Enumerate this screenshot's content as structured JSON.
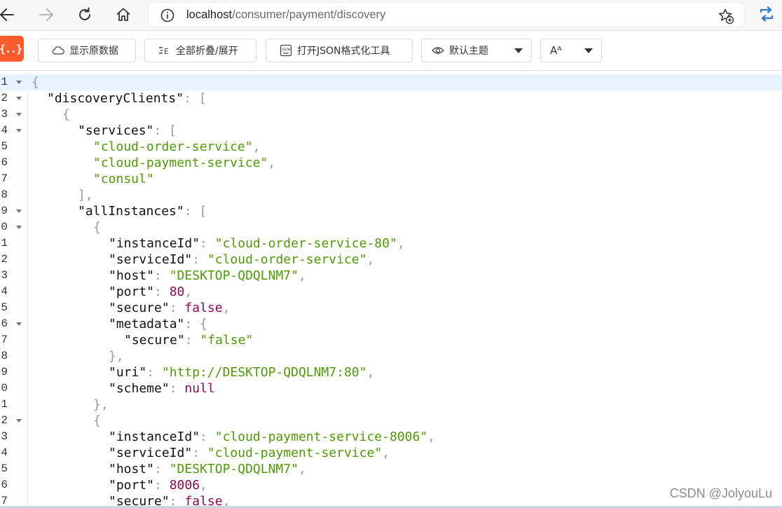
{
  "browser": {
    "url_host": "localhost",
    "url_path": "/consumer/payment/discovery"
  },
  "toolbar": {
    "logo_label": "{..}",
    "show_raw_label": "显示原数据",
    "fold_all_label": "全部折叠/展开",
    "open_formatter_label": "打开JSON格式化工具",
    "theme_label": "默认主题",
    "font_label": "Aᴬ"
  },
  "code": {
    "lines": [
      {
        "num": "1",
        "fold": true,
        "active": true,
        "indent": 0,
        "tokens": [
          {
            "t": "p",
            "v": "{"
          }
        ]
      },
      {
        "num": "2",
        "fold": true,
        "active": false,
        "indent": 1,
        "tokens": [
          {
            "t": "k",
            "v": "\"discoveryClients\""
          },
          {
            "t": "p",
            "v": ": ["
          }
        ]
      },
      {
        "num": "3",
        "fold": true,
        "active": false,
        "indent": 2,
        "tokens": [
          {
            "t": "p",
            "v": "{"
          }
        ]
      },
      {
        "num": "4",
        "fold": true,
        "active": false,
        "indent": 3,
        "tokens": [
          {
            "t": "k",
            "v": "\"services\""
          },
          {
            "t": "p",
            "v": ": ["
          }
        ]
      },
      {
        "num": "5",
        "fold": false,
        "active": false,
        "indent": 4,
        "tokens": [
          {
            "t": "s",
            "v": "\"cloud-order-service\""
          },
          {
            "t": "p",
            "v": ","
          }
        ]
      },
      {
        "num": "6",
        "fold": false,
        "active": false,
        "indent": 4,
        "tokens": [
          {
            "t": "s",
            "v": "\"cloud-payment-service\""
          },
          {
            "t": "p",
            "v": ","
          }
        ]
      },
      {
        "num": "7",
        "fold": false,
        "active": false,
        "indent": 4,
        "tokens": [
          {
            "t": "s",
            "v": "\"consul\""
          }
        ]
      },
      {
        "num": "8",
        "fold": false,
        "active": false,
        "indent": 3,
        "tokens": [
          {
            "t": "p",
            "v": "],"
          }
        ]
      },
      {
        "num": "9",
        "fold": true,
        "active": false,
        "indent": 3,
        "tokens": [
          {
            "t": "k",
            "v": "\"allInstances\""
          },
          {
            "t": "p",
            "v": ": ["
          }
        ]
      },
      {
        "num": "0",
        "fold": true,
        "active": false,
        "indent": 4,
        "tokens": [
          {
            "t": "p",
            "v": "{"
          }
        ]
      },
      {
        "num": "1",
        "fold": false,
        "active": false,
        "indent": 5,
        "tokens": [
          {
            "t": "k",
            "v": "\"instanceId\""
          },
          {
            "t": "p",
            "v": ": "
          },
          {
            "t": "s",
            "v": "\"cloud-order-service-80\""
          },
          {
            "t": "p",
            "v": ","
          }
        ]
      },
      {
        "num": "2",
        "fold": false,
        "active": false,
        "indent": 5,
        "tokens": [
          {
            "t": "k",
            "v": "\"serviceId\""
          },
          {
            "t": "p",
            "v": ": "
          },
          {
            "t": "s",
            "v": "\"cloud-order-service\""
          },
          {
            "t": "p",
            "v": ","
          }
        ]
      },
      {
        "num": "3",
        "fold": false,
        "active": false,
        "indent": 5,
        "tokens": [
          {
            "t": "k",
            "v": "\"host\""
          },
          {
            "t": "p",
            "v": ": "
          },
          {
            "t": "s",
            "v": "\"DESKTOP-QDQLNM7\""
          },
          {
            "t": "p",
            "v": ","
          }
        ]
      },
      {
        "num": "4",
        "fold": false,
        "active": false,
        "indent": 5,
        "tokens": [
          {
            "t": "k",
            "v": "\"port\""
          },
          {
            "t": "p",
            "v": ": "
          },
          {
            "t": "n",
            "v": "80"
          },
          {
            "t": "p",
            "v": ","
          }
        ]
      },
      {
        "num": "5",
        "fold": false,
        "active": false,
        "indent": 5,
        "tokens": [
          {
            "t": "k",
            "v": "\"secure\""
          },
          {
            "t": "p",
            "v": ": "
          },
          {
            "t": "b",
            "v": "false"
          },
          {
            "t": "p",
            "v": ","
          }
        ]
      },
      {
        "num": "6",
        "fold": true,
        "active": false,
        "indent": 5,
        "tokens": [
          {
            "t": "k",
            "v": "\"metadata\""
          },
          {
            "t": "p",
            "v": ": {"
          }
        ]
      },
      {
        "num": "7",
        "fold": false,
        "active": false,
        "indent": 6,
        "tokens": [
          {
            "t": "k",
            "v": "\"secure\""
          },
          {
            "t": "p",
            "v": ": "
          },
          {
            "t": "s",
            "v": "\"false\""
          }
        ]
      },
      {
        "num": "8",
        "fold": false,
        "active": false,
        "indent": 5,
        "tokens": [
          {
            "t": "p",
            "v": "},"
          }
        ]
      },
      {
        "num": "9",
        "fold": false,
        "active": false,
        "indent": 5,
        "tokens": [
          {
            "t": "k",
            "v": "\"uri\""
          },
          {
            "t": "p",
            "v": ": "
          },
          {
            "t": "s",
            "v": "\"http://DESKTOP-QDQLNM7:80\""
          },
          {
            "t": "p",
            "v": ","
          }
        ]
      },
      {
        "num": "0",
        "fold": false,
        "active": false,
        "indent": 5,
        "tokens": [
          {
            "t": "k",
            "v": "\"scheme\""
          },
          {
            "t": "p",
            "v": ": "
          },
          {
            "t": "b",
            "v": "null"
          }
        ]
      },
      {
        "num": "1",
        "fold": false,
        "active": false,
        "indent": 4,
        "tokens": [
          {
            "t": "p",
            "v": "},"
          }
        ]
      },
      {
        "num": "2",
        "fold": true,
        "active": false,
        "indent": 4,
        "tokens": [
          {
            "t": "p",
            "v": "{"
          }
        ]
      },
      {
        "num": "3",
        "fold": false,
        "active": false,
        "indent": 5,
        "tokens": [
          {
            "t": "k",
            "v": "\"instanceId\""
          },
          {
            "t": "p",
            "v": ": "
          },
          {
            "t": "s",
            "v": "\"cloud-payment-service-8006\""
          },
          {
            "t": "p",
            "v": ","
          }
        ]
      },
      {
        "num": "4",
        "fold": false,
        "active": false,
        "indent": 5,
        "tokens": [
          {
            "t": "k",
            "v": "\"serviceId\""
          },
          {
            "t": "p",
            "v": ": "
          },
          {
            "t": "s",
            "v": "\"cloud-payment-service\""
          },
          {
            "t": "p",
            "v": ","
          }
        ]
      },
      {
        "num": "5",
        "fold": false,
        "active": false,
        "indent": 5,
        "tokens": [
          {
            "t": "k",
            "v": "\"host\""
          },
          {
            "t": "p",
            "v": ": "
          },
          {
            "t": "s",
            "v": "\"DESKTOP-QDQLNM7\""
          },
          {
            "t": "p",
            "v": ","
          }
        ]
      },
      {
        "num": "6",
        "fold": false,
        "active": false,
        "indent": 5,
        "tokens": [
          {
            "t": "k",
            "v": "\"port\""
          },
          {
            "t": "p",
            "v": ": "
          },
          {
            "t": "n",
            "v": "8006"
          },
          {
            "t": "p",
            "v": ","
          }
        ]
      },
      {
        "num": "7",
        "fold": false,
        "active": false,
        "indent": 5,
        "tokens": [
          {
            "t": "k",
            "v": "\"secure\""
          },
          {
            "t": "p",
            "v": ": "
          },
          {
            "t": "b",
            "v": "false"
          },
          {
            "t": "p",
            "v": ","
          }
        ]
      }
    ]
  },
  "watermark": "CSDN @JolyouLu"
}
